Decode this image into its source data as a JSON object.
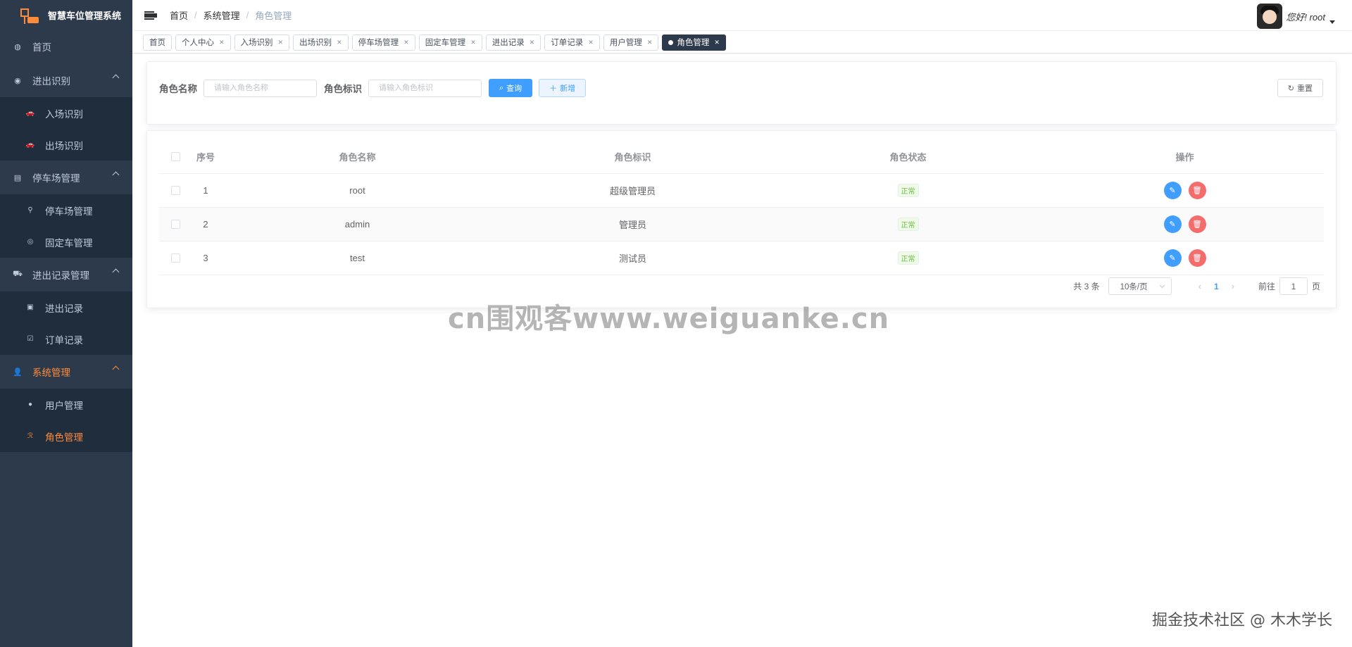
{
  "app": {
    "title": "智慧车位管理系统"
  },
  "sidebar": {
    "items": [
      {
        "label": "首页",
        "icon": "dashboard-icon"
      },
      {
        "label": "进出识别",
        "icon": "camera-icon",
        "children": [
          {
            "label": "入场识别",
            "icon": "car-in-icon"
          },
          {
            "label": "出场识别",
            "icon": "car-out-icon"
          }
        ]
      },
      {
        "label": "停车场管理",
        "icon": "parking-icon",
        "children": [
          {
            "label": "停车场管理",
            "icon": "lot-icon"
          },
          {
            "label": "固定车管理",
            "icon": "fixed-car-icon"
          }
        ]
      },
      {
        "label": "进出记录管理",
        "icon": "record-icon",
        "children": [
          {
            "label": "进出记录",
            "icon": "log-icon"
          },
          {
            "label": "订单记录",
            "icon": "order-icon"
          }
        ]
      },
      {
        "label": "系统管理",
        "icon": "system-icon",
        "children": [
          {
            "label": "用户管理",
            "icon": "user-icon"
          },
          {
            "label": "角色管理",
            "icon": "role-icon"
          }
        ]
      }
    ]
  },
  "header": {
    "breadcrumb": [
      "首页",
      "系统管理",
      "角色管理"
    ],
    "greeting": "您好! root"
  },
  "tags": [
    "首页",
    "个人中心",
    "入场识别",
    "出场识别",
    "停车场管理",
    "固定车管理",
    "进出记录",
    "订单记录",
    "用户管理",
    "角色管理"
  ],
  "search": {
    "name_label": "角色名称",
    "name_placeholder": "请输入角色名称",
    "key_label": "角色标识",
    "key_placeholder": "请输入角色标识",
    "query_label": "查询",
    "add_label": "新增",
    "reset_label": "重置"
  },
  "table": {
    "columns": [
      "序号",
      "角色名称",
      "角色标识",
      "角色状态",
      "操作"
    ],
    "rows": [
      {
        "idx": "1",
        "name": "root",
        "key": "超级管理员",
        "status": "正常"
      },
      {
        "idx": "2",
        "name": "admin",
        "key": "管理员",
        "status": "正常"
      },
      {
        "idx": "3",
        "name": "test",
        "key": "测试员",
        "status": "正常"
      }
    ]
  },
  "pagination": {
    "total": "共 3 条",
    "page_size": "10条/页",
    "current": "1",
    "goto_prefix": "前往",
    "goto_value": "1",
    "goto_suffix": "页"
  },
  "watermark": "cn围观客www.weiguanke.cn",
  "corner_mark": "掘金技术社区 @ 木木学长",
  "colors": {
    "sidebar_bg": "#2d3a4b",
    "accent": "#ff8c3a",
    "primary": "#409eff",
    "danger": "#f56c6c",
    "success": "#67c23a"
  }
}
